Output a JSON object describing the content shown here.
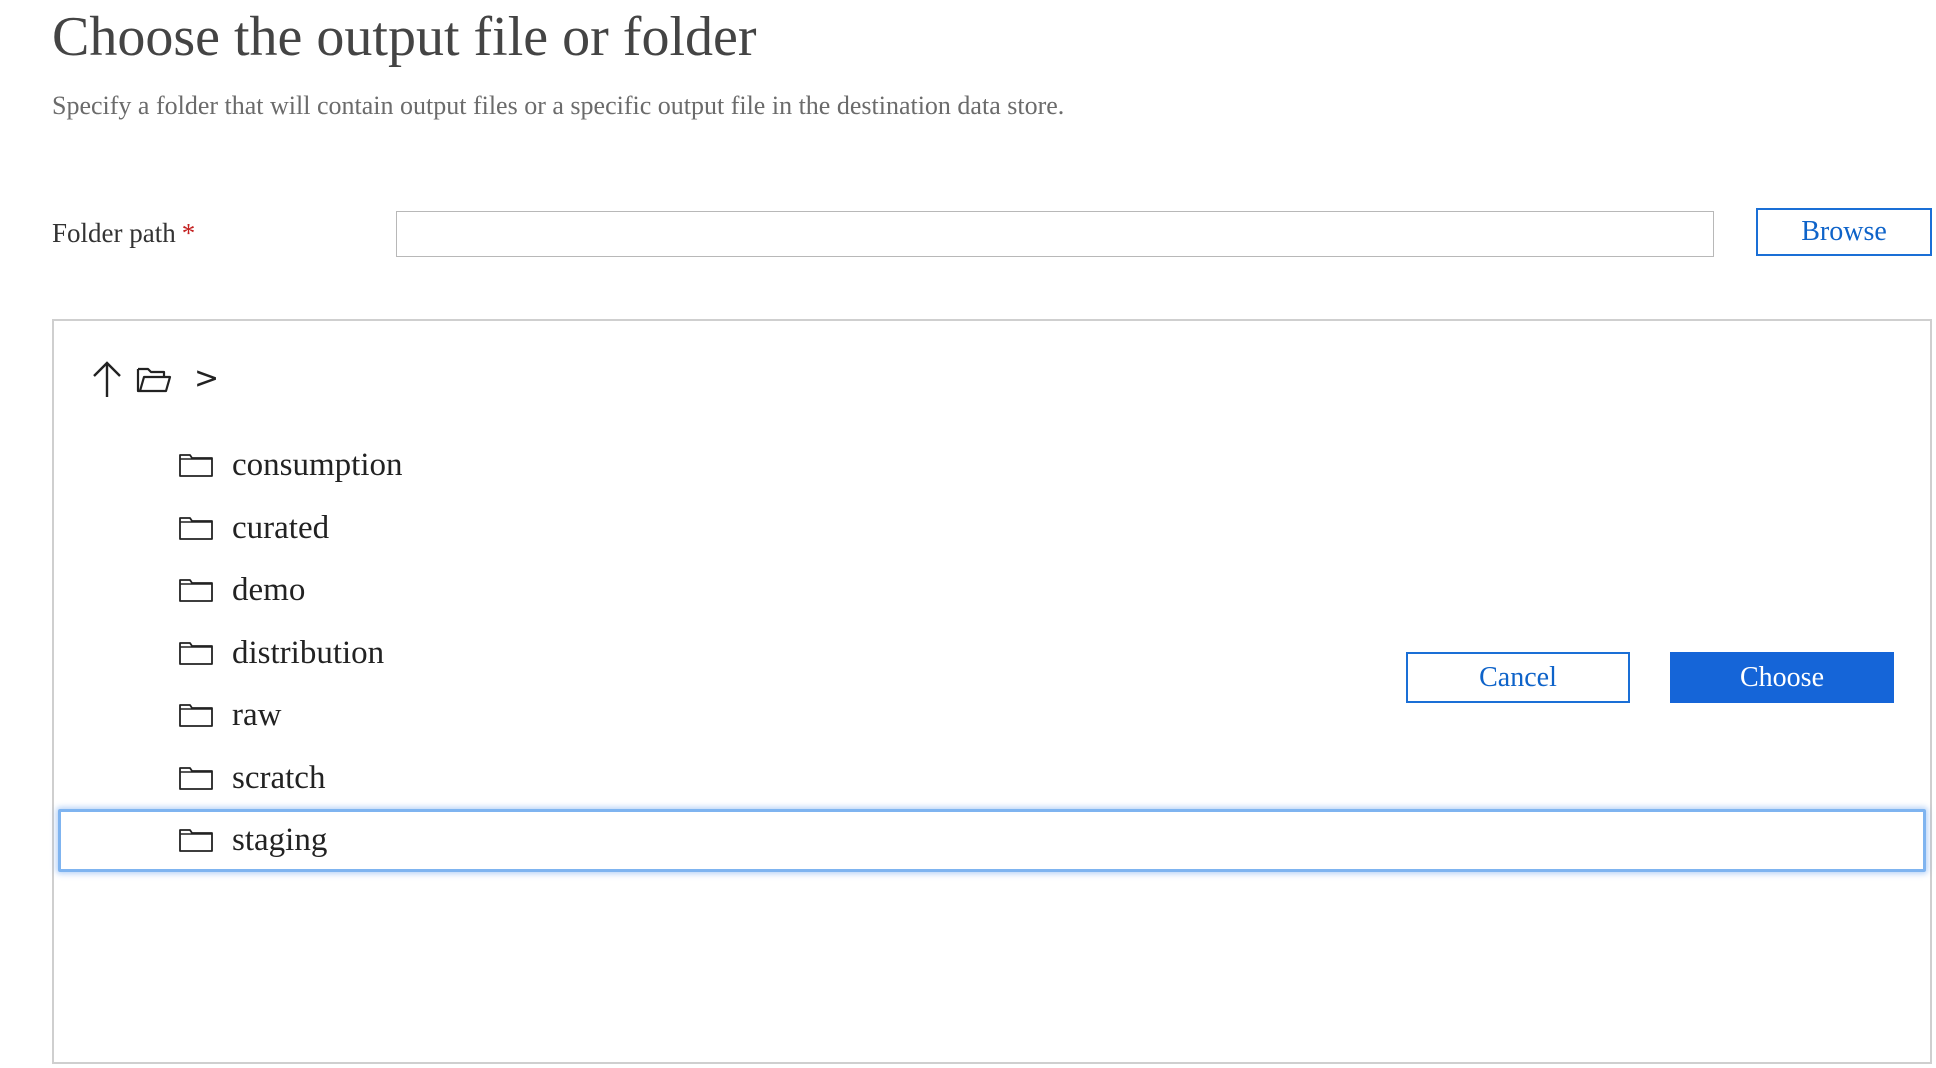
{
  "dialog": {
    "title": "Choose the output file or folder",
    "subtitle": "Specify a folder that will contain output files or a specific output file in the destination data store."
  },
  "folder_path": {
    "label": "Folder path",
    "required_marker": "*",
    "value": "",
    "browse_label": "Browse"
  },
  "browser": {
    "toolbar": {
      "up_icon": "arrow-up-icon",
      "open_icon": "open-folder-icon",
      "breadcrumb_separator": ">"
    },
    "folder_icon": "folder-icon",
    "folders": [
      {
        "name": "consumption",
        "selected": false
      },
      {
        "name": "curated",
        "selected": false
      },
      {
        "name": "demo",
        "selected": false
      },
      {
        "name": "distribution",
        "selected": false
      },
      {
        "name": "raw",
        "selected": false
      },
      {
        "name": "scratch",
        "selected": false
      },
      {
        "name": "staging",
        "selected": true
      }
    ]
  },
  "actions": {
    "cancel_label": "Cancel",
    "choose_label": "Choose"
  },
  "colors": {
    "accent": "#1565d8",
    "required": "#c42121",
    "selection_border": "#7fb4f0"
  }
}
